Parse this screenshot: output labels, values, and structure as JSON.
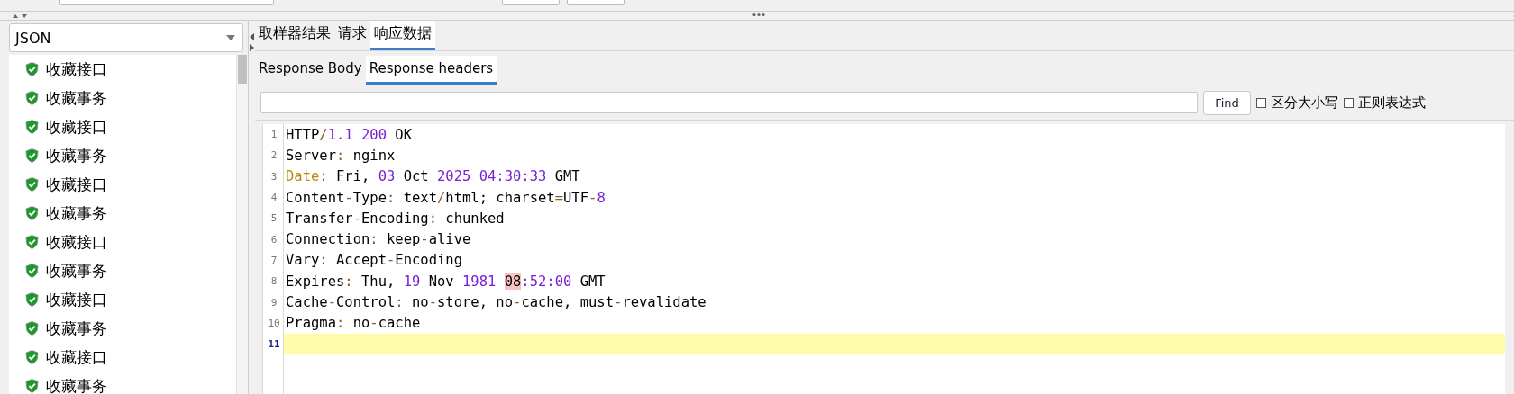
{
  "sidebar": {
    "renderer": {
      "value": "JSON"
    },
    "items": [
      {
        "label": "收藏接口"
      },
      {
        "label": "收藏事务"
      },
      {
        "label": "收藏接口"
      },
      {
        "label": "收藏事务"
      },
      {
        "label": "收藏接口"
      },
      {
        "label": "收藏事务"
      },
      {
        "label": "收藏接口"
      },
      {
        "label": "收藏事务"
      },
      {
        "label": "收藏接口"
      },
      {
        "label": "收藏事务"
      },
      {
        "label": "收藏接口"
      },
      {
        "label": "收藏事务"
      }
    ]
  },
  "tabs": [
    {
      "label": "取样器结果",
      "selected": false
    },
    {
      "label": "请求",
      "selected": false
    },
    {
      "label": "响应数据",
      "selected": true
    }
  ],
  "subtabs": [
    {
      "label": "Response Body",
      "selected": false
    },
    {
      "label": "Response headers",
      "selected": true
    }
  ],
  "search": {
    "button": "Find",
    "options": [
      {
        "label": "区分大小写",
        "checked": false
      },
      {
        "label": "正则表达式",
        "checked": false
      }
    ]
  },
  "editor": {
    "lines": [
      {
        "number": "1",
        "current": false,
        "segments": [
          {
            "kind": "plain",
            "text": "HTTP"
          },
          {
            "kind": "punct",
            "text": "/"
          },
          {
            "kind": "num",
            "text": "1.1"
          },
          {
            "kind": "num",
            "text": " 200"
          },
          {
            "kind": "plain",
            "text": " OK"
          }
        ]
      },
      {
        "number": "2",
        "current": false,
        "segments": [
          {
            "kind": "plain",
            "text": "Server"
          },
          {
            "kind": "punct",
            "text": ":"
          },
          {
            "kind": "plain",
            "text": " nginx"
          }
        ]
      },
      {
        "number": "3",
        "current": false,
        "segments": [
          {
            "kind": "keyword",
            "text": "Date"
          },
          {
            "kind": "punct",
            "text": ":"
          },
          {
            "kind": "plain",
            "text": " Fri, "
          },
          {
            "kind": "num",
            "text": "03"
          },
          {
            "kind": "plain",
            "text": " Oct "
          },
          {
            "kind": "num",
            "text": "2025"
          },
          {
            "kind": "num",
            "text": " 04:30:33"
          },
          {
            "kind": "plain",
            "text": " GMT"
          }
        ]
      },
      {
        "number": "4",
        "current": false,
        "segments": [
          {
            "kind": "plain",
            "text": "Content"
          },
          {
            "kind": "punct",
            "text": "-"
          },
          {
            "kind": "plain",
            "text": "Type"
          },
          {
            "kind": "punct",
            "text": ":"
          },
          {
            "kind": "plain",
            "text": " text"
          },
          {
            "kind": "punct",
            "text": "/"
          },
          {
            "kind": "plain",
            "text": "html; charset"
          },
          {
            "kind": "punct",
            "text": "="
          },
          {
            "kind": "plain",
            "text": "UTF"
          },
          {
            "kind": "punct",
            "text": "-"
          },
          {
            "kind": "num",
            "text": "8"
          }
        ]
      },
      {
        "number": "5",
        "current": false,
        "segments": [
          {
            "kind": "plain",
            "text": "Transfer"
          },
          {
            "kind": "punct",
            "text": "-"
          },
          {
            "kind": "plain",
            "text": "Encoding"
          },
          {
            "kind": "punct",
            "text": ":"
          },
          {
            "kind": "plain",
            "text": " chunked"
          }
        ]
      },
      {
        "number": "6",
        "current": false,
        "segments": [
          {
            "kind": "plain",
            "text": "Connection"
          },
          {
            "kind": "punct",
            "text": ":"
          },
          {
            "kind": "plain",
            "text": " keep"
          },
          {
            "kind": "punct",
            "text": "-"
          },
          {
            "kind": "plain",
            "text": "alive"
          }
        ]
      },
      {
        "number": "7",
        "current": false,
        "segments": [
          {
            "kind": "plain",
            "text": "Vary"
          },
          {
            "kind": "punct",
            "text": ":"
          },
          {
            "kind": "plain",
            "text": " Accept"
          },
          {
            "kind": "punct",
            "text": "-"
          },
          {
            "kind": "plain",
            "text": "Encoding"
          }
        ]
      },
      {
        "number": "8",
        "current": false,
        "segments": [
          {
            "kind": "plain",
            "text": "Expires"
          },
          {
            "kind": "punct",
            "text": ":"
          },
          {
            "kind": "plain",
            "text": " Thu, "
          },
          {
            "kind": "num",
            "text": "19"
          },
          {
            "kind": "plain",
            "text": " Nov "
          },
          {
            "kind": "num",
            "text": "1981 "
          },
          {
            "kind": "match",
            "text": "08"
          },
          {
            "kind": "num",
            "text": ":52:00"
          },
          {
            "kind": "plain",
            "text": " GMT"
          }
        ]
      },
      {
        "number": "9",
        "current": false,
        "segments": [
          {
            "kind": "plain",
            "text": "Cache"
          },
          {
            "kind": "punct",
            "text": "-"
          },
          {
            "kind": "plain",
            "text": "Control"
          },
          {
            "kind": "punct",
            "text": ":"
          },
          {
            "kind": "plain",
            "text": " no"
          },
          {
            "kind": "punct",
            "text": "-"
          },
          {
            "kind": "plain",
            "text": "store, no"
          },
          {
            "kind": "punct",
            "text": "-"
          },
          {
            "kind": "plain",
            "text": "cache, must"
          },
          {
            "kind": "punct",
            "text": "-"
          },
          {
            "kind": "plain",
            "text": "revalidate"
          }
        ]
      },
      {
        "number": "10",
        "current": false,
        "segments": [
          {
            "kind": "plain",
            "text": "Pragma"
          },
          {
            "kind": "punct",
            "text": ":"
          },
          {
            "kind": "plain",
            "text": " no"
          },
          {
            "kind": "punct",
            "text": "-"
          },
          {
            "kind": "plain",
            "text": "cache"
          }
        ]
      },
      {
        "number": "11",
        "current": true
      }
    ]
  }
}
